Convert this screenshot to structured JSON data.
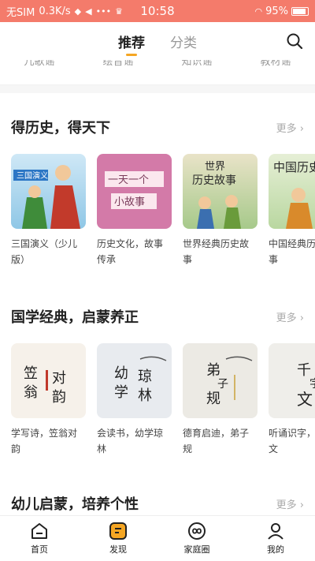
{
  "status_bar": {
    "carrier": "无SIM",
    "speed": "0.3K/s",
    "time": "10:58",
    "battery": "95%"
  },
  "top_nav": {
    "tabs": [
      "推荐",
      "分类"
    ],
    "active_tab": "推荐"
  },
  "category_chips": [
    "儿歌谣",
    "绘音谣",
    "知识谣",
    "教材谣"
  ],
  "sections": [
    {
      "title": "得历史，得天下",
      "more": "更多",
      "books": [
        {
          "title": "三国演义（少儿版）",
          "cover_text": "三国演义"
        },
        {
          "title": "历史文化，故事传承",
          "cover_text": "一天一个小故事"
        },
        {
          "title": "世界经典历史故事",
          "cover_text": "世界历史故事"
        },
        {
          "title": "中国经典历史故事",
          "cover_text": "中国历史"
        }
      ]
    },
    {
      "title": "国学经典，启蒙养正",
      "more": "更多",
      "books": [
        {
          "title": "学写诗，笠翁对韵",
          "cover_text": "笠翁对韵"
        },
        {
          "title": "会读书，幼学琼林",
          "cover_text": "幼学琼林"
        },
        {
          "title": "德育启迪，弟子规",
          "cover_text": "弟子规"
        },
        {
          "title": "听诵识字，千字文",
          "cover_text": "千字文"
        }
      ]
    },
    {
      "title": "幼儿启蒙，培养个性",
      "more": "更多",
      "books": []
    }
  ],
  "bottom_nav": [
    "首页",
    "发现",
    "家庭圈",
    "我的"
  ],
  "colors": {
    "status_bar": "#f47b6b",
    "accent": "#f5a623"
  }
}
